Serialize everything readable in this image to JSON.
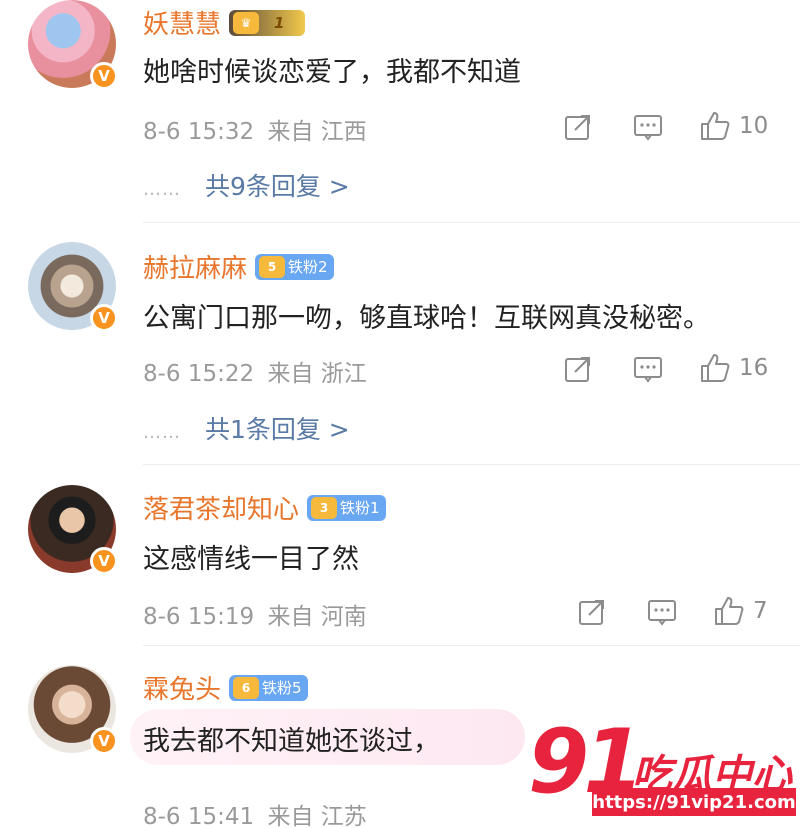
{
  "comments": [
    {
      "name": "妖慧慧",
      "medal": {
        "label": "",
        "level": "1",
        "bg": "#f2c94c"
      },
      "text": "她啥时候谈恋爱了，我都不知道",
      "time": "8-6 15:32",
      "source": "来自 江西",
      "likes": "10",
      "dots": "……",
      "replies": "共9条回复 >"
    },
    {
      "name": "赫拉麻麻",
      "medal": {
        "label": "铁粉2",
        "level": "5",
        "bg": "#6aa7f2"
      },
      "text": "公寓门口那一吻，够直球哈！互联网真没秘密。",
      "time": "8-6 15:22",
      "source": "来自 浙江",
      "likes": "16",
      "dots": "……",
      "replies": "共1条回复 >"
    },
    {
      "name": "落君茶却知心",
      "medal": {
        "label": "铁粉1",
        "level": "3",
        "bg": "#6aa7f2"
      },
      "text": "这感情线一目了然",
      "time": "8-6 15:19",
      "source": "来自 河南",
      "likes": "7"
    },
    {
      "name": "霖兔头",
      "medal": {
        "label": "铁粉5",
        "level": "6",
        "bg": "#6aa7f2"
      },
      "text": "我去都不知道她还谈过，",
      "time": "8-6 15:41",
      "source": "来自 江苏"
    }
  ],
  "watermark": {
    "number": "91",
    "brand": "吃瓜中心",
    "url": "https://91vip21.com"
  },
  "colors": {
    "name": "#e8762c",
    "link": "#5a7aa6",
    "meta": "#9a9a9a",
    "brand": "#e8233e"
  },
  "icons": [
    "share-icon",
    "comment-icon",
    "like-icon",
    "verified-badge-icon",
    "crown-icon"
  ]
}
